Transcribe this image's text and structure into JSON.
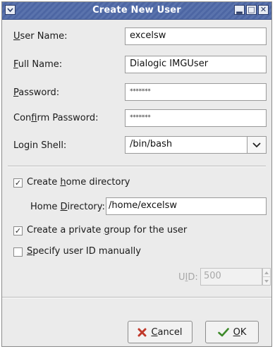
{
  "window": {
    "title": "Create New User",
    "menu_icon": "chevron-down-icon",
    "minimize_glyph": "▂",
    "maximize_glyph": "□",
    "close_glyph": "✕"
  },
  "form": {
    "user_name": {
      "label_u": "U",
      "label_rest": "ser Name:",
      "value": "excelsw"
    },
    "full_name": {
      "label_u": "F",
      "label_rest": "ull Name:",
      "value": "Dialogic IMGUser"
    },
    "password": {
      "label_u": "P",
      "label_rest": "assword:",
      "value": "*******"
    },
    "confirm_password": {
      "label_pre": "Con",
      "label_u": "f",
      "label_rest": "irm Password:",
      "value": "*******"
    },
    "login_shell": {
      "label_pre": "Lo",
      "label_u": "g",
      "label_rest": "in Shell:",
      "value": "/bin/bash"
    }
  },
  "home": {
    "checkbox_pre": "Create ",
    "checkbox_u": "h",
    "checkbox_rest": "ome directory",
    "checked": true,
    "dir_label_pre": "Home ",
    "dir_label_u": "D",
    "dir_label_rest": "irectory:",
    "dir_value": "/home/excelsw"
  },
  "private_group": {
    "pre": "Create a private ",
    "u": "g",
    "rest": "roup for the user",
    "checked": true
  },
  "uid_manual": {
    "u": "S",
    "rest": "pecify user ID manually",
    "checked": false
  },
  "uid": {
    "label_pre": "U",
    "label_u": "I",
    "label_rest": "D:",
    "value": "500"
  },
  "buttons": {
    "cancel_u": "C",
    "cancel_rest": "ancel",
    "ok_u": "O",
    "ok_rest": "K"
  },
  "colors": {
    "titlebar": "#5a73ad",
    "cancel_icon": "#c0392b",
    "ok_icon": "#3d8a2a"
  }
}
